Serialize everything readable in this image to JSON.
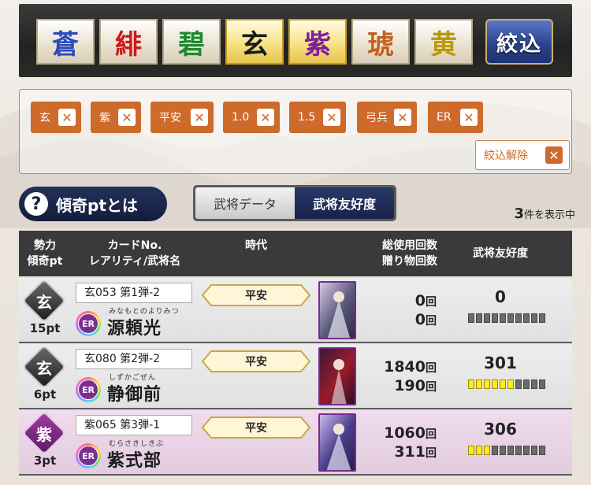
{
  "factions": [
    {
      "label": "蒼",
      "color": "#2a4bb8",
      "selected": false
    },
    {
      "label": "緋",
      "color": "#cc1a1a",
      "selected": false
    },
    {
      "label": "碧",
      "color": "#1c8a2c",
      "selected": false
    },
    {
      "label": "玄",
      "color": "#1a1a1a",
      "selected": true
    },
    {
      "label": "紫",
      "color": "#7b1f9e",
      "selected": true
    },
    {
      "label": "琥",
      "color": "#c4601c",
      "selected": false
    },
    {
      "label": "黄",
      "color": "#b69a0c",
      "selected": false
    }
  ],
  "filter_button_label": "絞込",
  "active_filters": [
    "玄",
    "紫",
    "平安",
    "1.0",
    "1.5",
    "弓兵",
    "ER"
  ],
  "clear_filter_label": "絞込解除",
  "close_glyph": "✕",
  "info_pill": {
    "icon": "?",
    "label": "傾奇ptとは"
  },
  "tabs": [
    {
      "label": "武将データ",
      "active": false
    },
    {
      "label": "武将友好度",
      "active": true
    }
  ],
  "result_count": {
    "number": "3",
    "suffix": "件を表示中"
  },
  "table_headers": {
    "faction": [
      "勢力",
      "傾奇pt"
    ],
    "card": [
      "カードNo.",
      "レアリティ/武将名"
    ],
    "era": "時代",
    "usage": [
      "総使用回数",
      "贈り物回数"
    ],
    "friendship": "武将友好度"
  },
  "rows": [
    {
      "faction_glyph": "玄",
      "badge_style": "dark",
      "pts": "15pt",
      "card_no": "玄053 第1弾-2",
      "rarity": "ER",
      "ruby": "みなもとのよりみつ",
      "name": "源頼光",
      "era": "平安",
      "usage": "0",
      "gifts": "0",
      "count_unit": "回",
      "friendship": "0",
      "friendship_level": 0,
      "row_style": "grey"
    },
    {
      "faction_glyph": "玄",
      "badge_style": "dark",
      "pts": "6pt",
      "card_no": "玄080 第2弾-2",
      "rarity": "ER",
      "ruby": "しずかごぜん",
      "name": "静御前",
      "era": "平安",
      "usage": "1840",
      "gifts": "190",
      "count_unit": "回",
      "friendship": "301",
      "friendship_level": 6,
      "row_style": "grey"
    },
    {
      "faction_glyph": "紫",
      "badge_style": "violet",
      "pts": "3pt",
      "card_no": "紫065 第3弾-1",
      "rarity": "ER",
      "ruby": "むらさきしきぶ",
      "name": "紫式部",
      "era": "平安",
      "usage": "1060",
      "gifts": "311",
      "count_unit": "回",
      "friendship": "306",
      "friendship_level": 3,
      "row_style": "purple"
    }
  ]
}
